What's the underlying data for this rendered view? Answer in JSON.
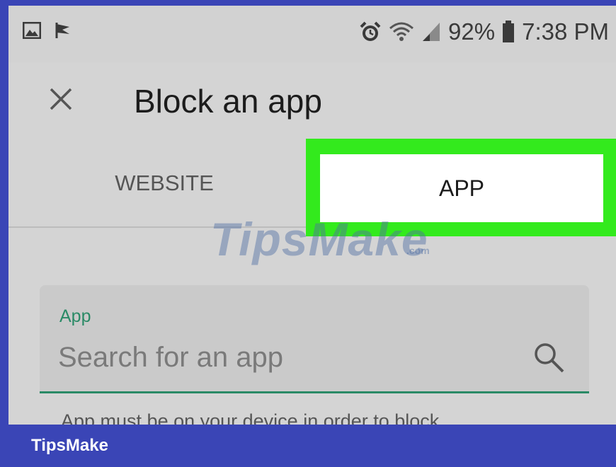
{
  "status_bar": {
    "left_icons": [
      "image-notification-icon",
      "flag-notification-icon"
    ],
    "right_icons": [
      "alarm-icon",
      "wifi-icon",
      "signal-icon",
      "battery-icon"
    ],
    "battery": "92%",
    "time": "7:38 PM"
  },
  "header": {
    "close_icon": "close-icon",
    "title": "Block an app"
  },
  "tabs": {
    "items": [
      {
        "label": "WEBSITE",
        "selected": false
      },
      {
        "label": "APP",
        "selected": true
      }
    ],
    "highlight_color": "#33ea1d"
  },
  "watermark": {
    "text": "TipsMake",
    "suffix": ".com"
  },
  "search": {
    "label": "App",
    "placeholder": "Search for an app",
    "value": "",
    "icon": "search-icon",
    "accent_color": "#2a8a66"
  },
  "helper_text": "App must be on your device in order to block",
  "footer": {
    "brand": "TipsMake",
    "color": "#3a45b6"
  }
}
